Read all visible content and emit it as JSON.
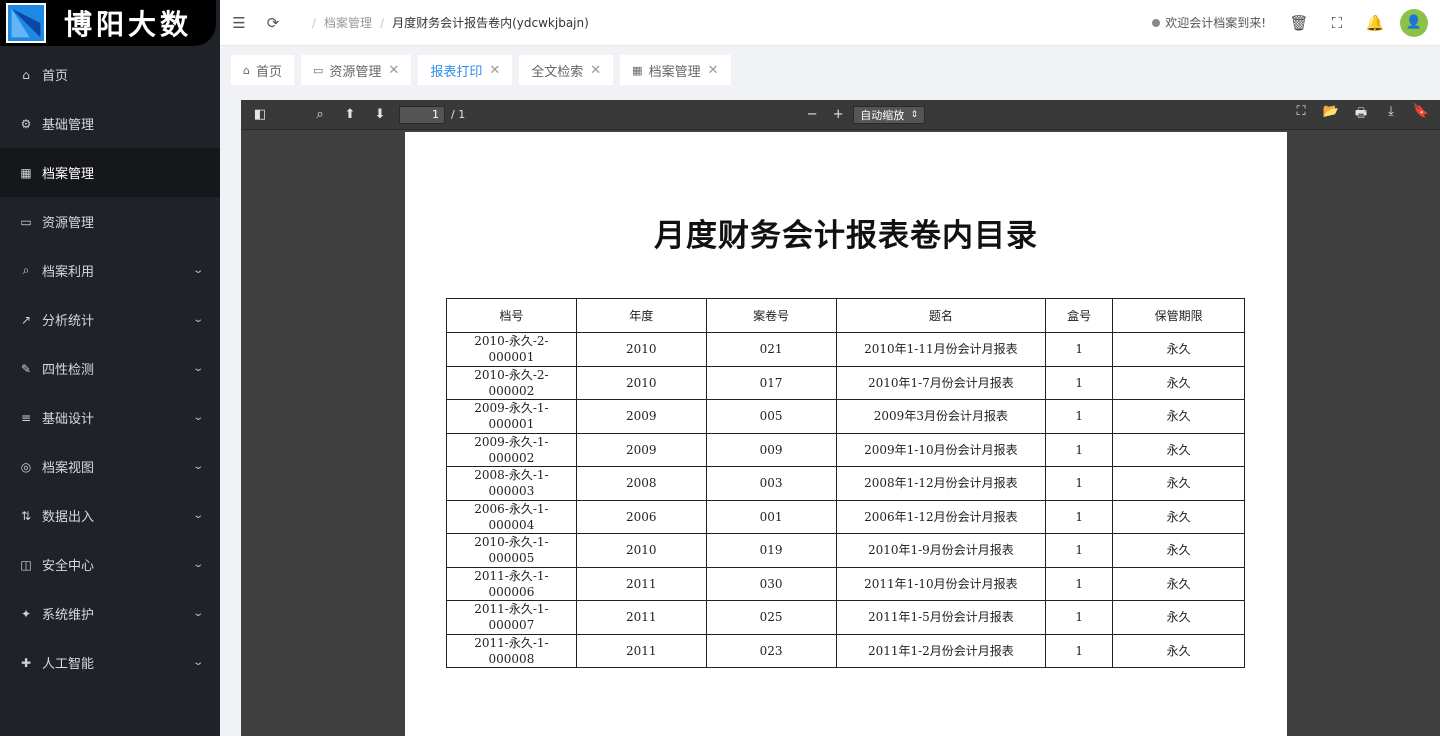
{
  "brand": {
    "name": "博阳大数"
  },
  "sidebar": {
    "items": [
      {
        "label": "首页",
        "icon": "⌂",
        "chevron": ""
      },
      {
        "label": "基础管理",
        "icon": "⚙",
        "chevron": ""
      },
      {
        "label": "档案管理",
        "icon": "▦",
        "chevron": ""
      },
      {
        "label": "资源管理",
        "icon": "▭",
        "chevron": ""
      },
      {
        "label": "档案利用",
        "icon": "⌕",
        "chevron": "⌄"
      },
      {
        "label": "分析统计",
        "icon": "↗",
        "chevron": "⌄"
      },
      {
        "label": "四性检测",
        "icon": "✎",
        "chevron": "⌄"
      },
      {
        "label": "基础设计",
        "icon": "≡",
        "chevron": "⌄"
      },
      {
        "label": "档案视图",
        "icon": "◎",
        "chevron": "⌄"
      },
      {
        "label": "数据出入",
        "icon": "⇅",
        "chevron": "⌄"
      },
      {
        "label": "安全中心",
        "icon": "◫",
        "chevron": "⌄"
      },
      {
        "label": "系统维护",
        "icon": "✦",
        "chevron": "⌄"
      },
      {
        "label": "人工智能",
        "icon": "✚",
        "chevron": "⌄"
      }
    ]
  },
  "header": {
    "breadcrumb": [
      "档案管理",
      "月度财务会计报告卷内(ydcwkjbajn)"
    ],
    "welcome": "欢迎会计档案到来!",
    "avatar": "👤"
  },
  "tabs": [
    {
      "label": "首页",
      "icon": "⌂",
      "closable": false
    },
    {
      "label": "资源管理",
      "icon": "▭",
      "closable": true
    },
    {
      "label": "报表打印",
      "icon": "",
      "closable": true
    },
    {
      "label": "全文检索",
      "icon": "",
      "closable": true
    },
    {
      "label": "档案管理",
      "icon": "▦",
      "closable": true
    }
  ],
  "viewer": {
    "page_value": "1",
    "page_count": "/ 1",
    "zoom": "自动缩放",
    "zoom_arrow": "⇕"
  },
  "document": {
    "title": "月度财务会计报表卷内目录",
    "columns": [
      "档号",
      "年度",
      "案卷号",
      "题名",
      "盒号",
      "保管期限"
    ],
    "rows": [
      [
        "2010-永久-2-\n000001",
        "2010",
        "021",
        "2010年1-11月份会计月报表",
        "1",
        "永久"
      ],
      [
        "2010-永久-2-\n000002",
        "2010",
        "017",
        "2010年1-7月份会计月报表",
        "1",
        "永久"
      ],
      [
        "2009-永久-1-\n000001",
        "2009",
        "005",
        "2009年3月份会计月报表",
        "1",
        "永久"
      ],
      [
        "2009-永久-1-\n000002",
        "2009",
        "009",
        "2009年1-10月份会计月报表",
        "1",
        "永久"
      ],
      [
        "2008-永久-1-\n000003",
        "2008",
        "003",
        "2008年1-12月份会计月报表",
        "1",
        "永久"
      ],
      [
        "2006-永久-1-\n000004",
        "2006",
        "001",
        "2006年1-12月份会计月报表",
        "1",
        "永久"
      ],
      [
        "2010-永久-1-\n000005",
        "2010",
        "019",
        "2010年1-9月份会计月报表",
        "1",
        "永久"
      ],
      [
        "2011-永久-1-\n000006",
        "2011",
        "030",
        "2011年1-10月份会计月报表",
        "1",
        "永久"
      ],
      [
        "2011-永久-1-\n000007",
        "2011",
        "025",
        "2011年1-5月份会计月报表",
        "1",
        "永久"
      ],
      [
        "2011-永久-1-\n000008",
        "2011",
        "023",
        "2011年1-2月份会计月报表",
        "1",
        "永久"
      ]
    ]
  },
  "colors": {
    "sidebar_bg": "#1f2329",
    "accent": "#2d8cf0",
    "viewer_bg": "#404040",
    "avatar": "#8bc34a"
  }
}
